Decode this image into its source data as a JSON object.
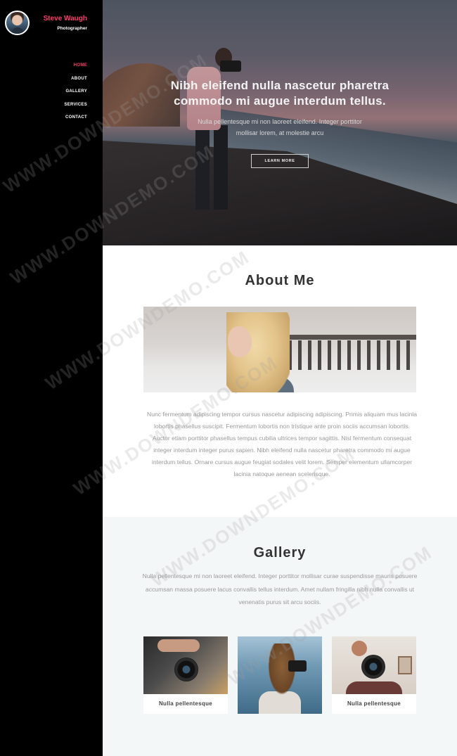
{
  "sidebar": {
    "name": "Steve Waugh",
    "role": "Photographer",
    "nav": [
      {
        "label": "HOME",
        "active": true
      },
      {
        "label": "ABOUT",
        "active": false
      },
      {
        "label": "GALLERY",
        "active": false
      },
      {
        "label": "SERVICES",
        "active": false
      },
      {
        "label": "CONTACT",
        "active": false
      }
    ]
  },
  "hero": {
    "title": "Nibh eleifend nulla nascetur pharetra commodo mi augue interdum tellus.",
    "subtitle": "Nulla pellentesque mi non laoreet eleifend. Integer porttitor mollisar lorem, at molestie arcu",
    "button": "LEARN MORE"
  },
  "about": {
    "title": "About Me",
    "text": "Nunc fermentum adipiscing tempor cursus nascetur adipiscing adipiscing. Primis aliquam mus lacinia lobortis phasellus suscipit. Fermentum lobortis non tristique ante proin sociis accumsan lobortis. Auctor etiam porttitor phasellus tempus cubilia ultrices tempor sagittis. Nisl fermentum consequat integer interdum integer purus sapien. Nibh eleifend nulla nascetur pharetra commodo mi augue interdum tellus. Ornare cursus augue feugiat sodales velit lorem. Semper elementum ullamcorper lacinia natoque aenean scelerisque."
  },
  "gallery": {
    "title": "Gallery",
    "text": "Nulla pellentesque mi non laoreet eleifend. Integer porttitor mollisar curae suspendisse mauris posuere accumsan massa posuere lacus convallis tellus interdum. Amet nullam fringilla nibh nulla convallis ut venenatis purus sit arcu sociis.",
    "cards": [
      {
        "caption": "Nulla pellentesque"
      },
      {
        "caption": ""
      },
      {
        "caption": "Nulla pellentesque"
      }
    ]
  },
  "watermark": "WWW.DOWNDEMO.COM",
  "colors": {
    "accent": "#ff3b6b",
    "sidebar_bg": "#000000",
    "gallery_bg": "#f4f7f8"
  }
}
